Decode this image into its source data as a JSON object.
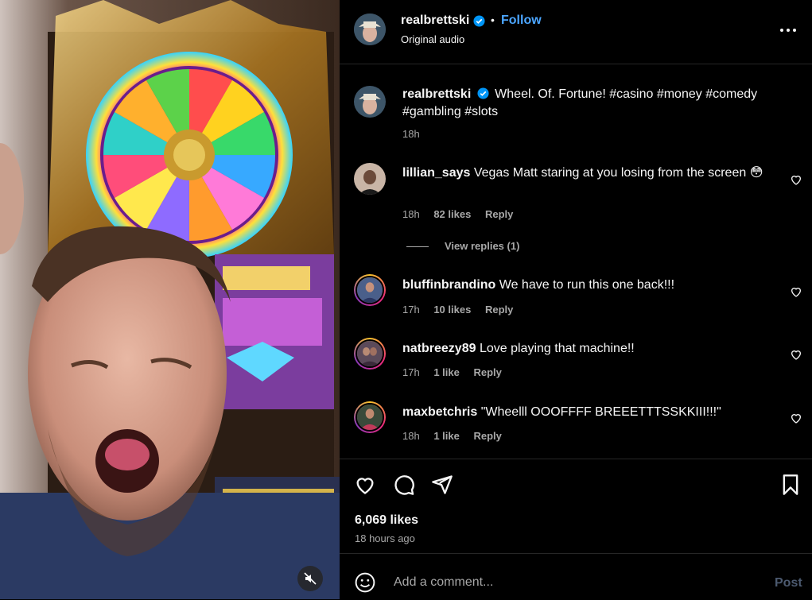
{
  "post": {
    "username": "realbrettski",
    "follow_label": "Follow",
    "separator": "•",
    "audio": "Original audio",
    "caption": "Wheel. Of. Fortune! #casino #money #comedy #gambling #slots",
    "caption_time": "18h"
  },
  "comments": [
    {
      "username": "lillian_says",
      "text": "Vegas Matt staring at you losing from the screen 😳",
      "time": "18h",
      "likes": "82 likes",
      "reply_label": "Reply"
    },
    {
      "username": "bluffinbrandino",
      "text": "We have to run this one back!!!",
      "time": "17h",
      "likes": "10 likes",
      "reply_label": "Reply"
    },
    {
      "username": "natbreezy89",
      "text": "Love playing that machine!!",
      "time": "17h",
      "likes": "1 like",
      "reply_label": "Reply"
    },
    {
      "username": "maxbetchris",
      "text": "\"Wheelll OOOFFFF BREEETTTSSKKIII!!!\"",
      "time": "18h",
      "likes": "1 like",
      "reply_label": "Reply"
    }
  ],
  "view_replies": "View replies (1)",
  "engagement": {
    "likes": "6,069 likes",
    "posted": "18 hours ago"
  },
  "composer": {
    "placeholder": "Add a comment...",
    "post_label": "Post"
  },
  "icons": {
    "header_more": "more-icon",
    "verified": "verified-badge-icon",
    "like": "heart-icon",
    "comment": "comment-icon",
    "share": "share-icon",
    "save": "bookmark-icon",
    "emoji": "emoji-icon",
    "mute": "muted-speaker-icon"
  },
  "colors": {
    "link_blue": "#4ca6ff",
    "muted_text": "#a8a8a8",
    "post_disabled": "#4c5a70"
  }
}
